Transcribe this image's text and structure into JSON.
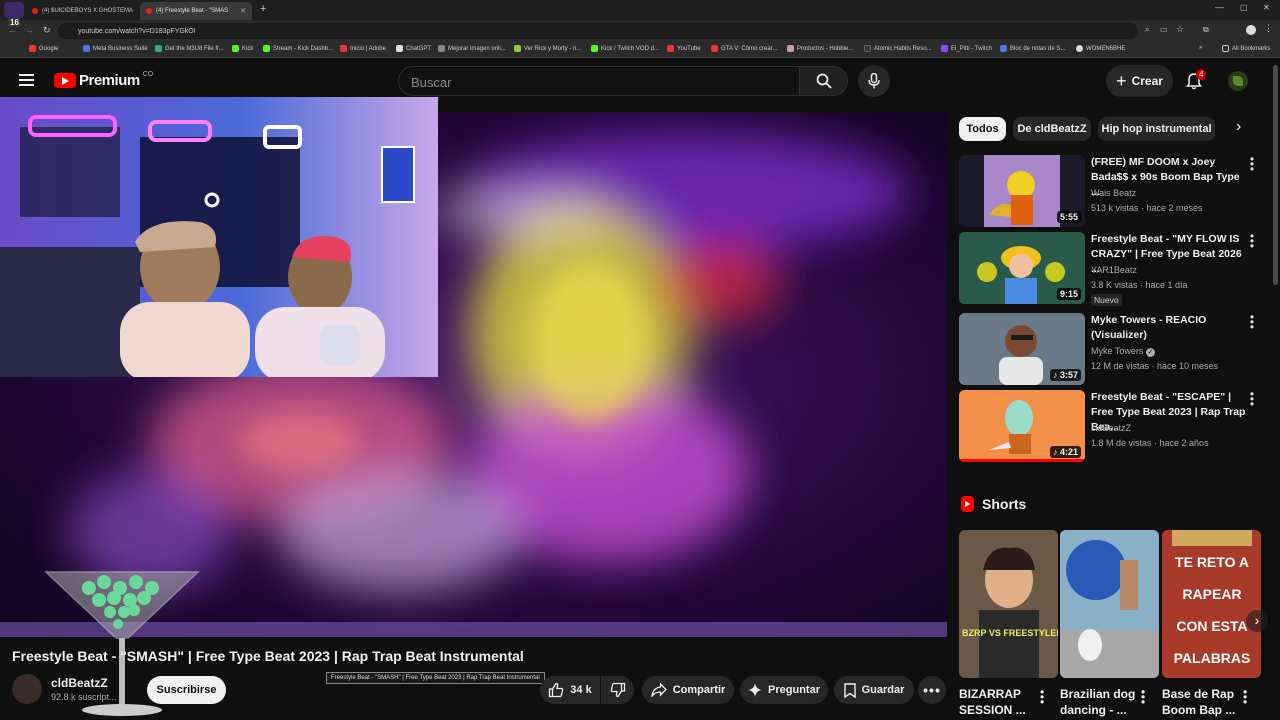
{
  "browser": {
    "tabs": [
      {
        "label": "(4) $UICIDEBOYS X GHOSTEMA",
        "active": false
      },
      {
        "label": "(4) Freestyle Beat - \"SMAS",
        "active": true
      }
    ],
    "tab_count_badge": "16",
    "url": "youtube.com/watch?v=D183pFYGkOI",
    "bookmarks": [
      "Google",
      "Meta Business Suite",
      "Get the M3U8 File fr...",
      "Kick",
      "Stream - Kick Dashb...",
      "Inicio | Adobe",
      "ChatGPT",
      "Mejorar imagen onli...",
      "Ver Rick y Morty - n...",
      "Kick / Twitch VOD d...",
      "YouTube",
      "GTA V: Cómo crear...",
      "Productos - Hobbie...",
      "Atomic Habits Reso...",
      "El_Pitti - Twitch",
      "Bloc de notas de S...",
      "WOMEN6BHE"
    ],
    "all_bookmarks": "All Bookmarks"
  },
  "youtube": {
    "logo_text": "Premium",
    "region": "CO",
    "search_placeholder": "Buscar",
    "create_label": "Crear",
    "notif_count": "4"
  },
  "video": {
    "title": "Freestyle Beat - \"SMASH\" | Free Type Beat 2023 | Rap Trap Beat Instrumental",
    "tooltip": "Freestyle Beat - \"SMASH\" | Free Type Beat 2023 | Rap Trap Beat Instrumental",
    "channel": "cldBeatzZ",
    "subscribers": "92.8 k suscript...",
    "subscribe_label": "Suscribirse",
    "likes": "34 k",
    "share_label": "Compartir",
    "ask_label": "Preguntar",
    "save_label": "Guardar"
  },
  "filters": [
    "Todos",
    "De cldBeatzZ",
    "Hip hop instrumental"
  ],
  "recommendations": [
    {
      "title": "(FREE) MF DOOM x Joey Bada$$ x 90s Boom Bap Type ...",
      "channel": "Wais Beatz",
      "meta": "513 k vistas · hace 2 meses",
      "duration": "5:55",
      "badge": "",
      "verified": false,
      "thumb_color": "#1a1a2a"
    },
    {
      "title": "Freestyle Beat - \"MY FLOW IS CRAZY\" | Free Type Beat 2026 ...",
      "channel": "YAR1Beatz",
      "meta": "3.8 K vistas · hace 1 día",
      "duration": "9:15",
      "badge": "Nuevo",
      "verified": false,
      "thumb_color": "#3a7a3a"
    },
    {
      "title": "Myke Towers - REACIO (Visualizer)",
      "channel": "Myke Towers",
      "meta": "12 M de vistas · hace 10 meses",
      "duration": "3:57",
      "badge": "",
      "verified": true,
      "thumb_color": "#5a6a7a"
    },
    {
      "title": "Freestyle Beat - \"ESCAPE\" | Free Type Beat 2023 | Rap Trap Bea...",
      "channel": "cldBeatzZ",
      "meta": "1.8 M de vistas · hace 2 años",
      "duration": "4:21",
      "badge": "",
      "verified": false,
      "thumb_color": "#f0884a"
    }
  ],
  "shorts": {
    "header": "Shorts",
    "items": [
      {
        "title": "BIZARRAP SESSION ...",
        "overlay": "BZRP VS FREESTYLERS",
        "thumb_color": "#5a4a3a"
      },
      {
        "title": "Brazilian dog dancing - ...",
        "overlay": "",
        "thumb_color": "#6a9ab8"
      },
      {
        "title": "Base de Rap Boom Bap ...",
        "overlay": "TE RETO A RAPEAR CON ESTA PALABRAS",
        "thumb_color": "#c8402a"
      }
    ]
  }
}
